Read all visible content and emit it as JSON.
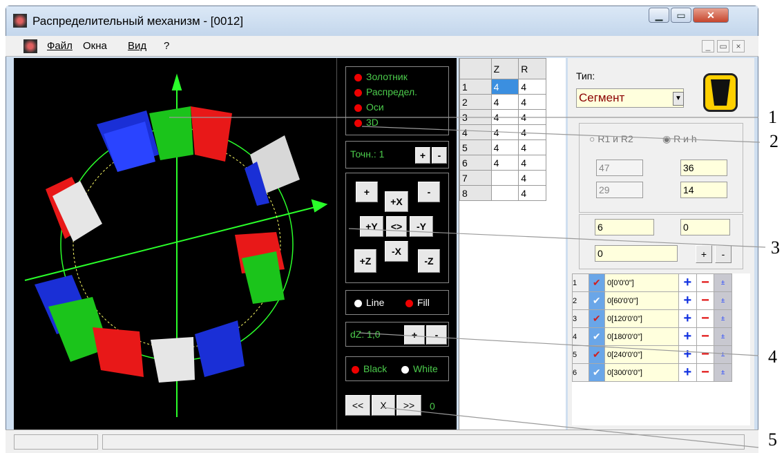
{
  "window": {
    "title": "Распределительный механизм - [0012]",
    "minimize": "▁",
    "maximize": "▭",
    "close": "✕"
  },
  "menu": {
    "items": [
      "Файл",
      "Окна",
      "Вид",
      "?"
    ],
    "mdi": [
      "_",
      "▭",
      "×"
    ]
  },
  "legend": {
    "items": [
      "Золотник",
      "Распредел.",
      "Оси",
      "3D"
    ]
  },
  "accuracy": {
    "label": "Точн.: 1",
    "plus": "+",
    "minus": "-"
  },
  "rotate": {
    "plus": "+",
    "minus": "-",
    "px": "+X",
    "py": "+Y",
    "center": "<>",
    "my": "-Y",
    "mx": "-X",
    "pz": "+Z",
    "mz": "-Z"
  },
  "render": {
    "line": "Line",
    "fill": "Fill"
  },
  "dz": {
    "label": "dZ: 1,0",
    "plus": "+",
    "minus": "-"
  },
  "bg": {
    "black": "Black",
    "white": "White"
  },
  "nav": {
    "prev": "<<",
    "stop": "X",
    "next": ">>",
    "value": "0"
  },
  "grid": {
    "headers": [
      "",
      "Z",
      "R"
    ],
    "rows": [
      [
        "1",
        "4",
        "4"
      ],
      [
        "2",
        "4",
        "4"
      ],
      [
        "3",
        "4",
        "4"
      ],
      [
        "4",
        "4",
        "4"
      ],
      [
        "5",
        "4",
        "4"
      ],
      [
        "6",
        "4",
        "4"
      ],
      [
        "7",
        "",
        "4"
      ],
      [
        "8",
        "",
        "4"
      ]
    ]
  },
  "props": {
    "type_label": "Тип:",
    "type_value": "Сегмент",
    "radio1": "R1 и R2",
    "radio2": "R и h",
    "v1": "47",
    "v2": "36",
    "v3": "29",
    "v4": "14",
    "v5": "6",
    "v6": "0",
    "v7": "0",
    "plus": "+",
    "minus": "-"
  },
  "list": {
    "rows": [
      [
        "1",
        "0[0'0'0\"]"
      ],
      [
        "2",
        "0[60'0'0\"]"
      ],
      [
        "3",
        "0[120'0'0\"]"
      ],
      [
        "4",
        "0[180'0'0\"]"
      ],
      [
        "5",
        "0[240'0'0\"]"
      ],
      [
        "6",
        "0[300'0'0\"]"
      ]
    ]
  },
  "callouts": [
    "1",
    "2",
    "3",
    "4",
    "5"
  ],
  "colors": {
    "accent_green": "#00ff00",
    "label_red": "#e00000",
    "segment_blue": "#1a2fd6",
    "segment_red": "#e81818",
    "segment_white": "#e6e6e6",
    "segment_green": "#1bc41b"
  }
}
